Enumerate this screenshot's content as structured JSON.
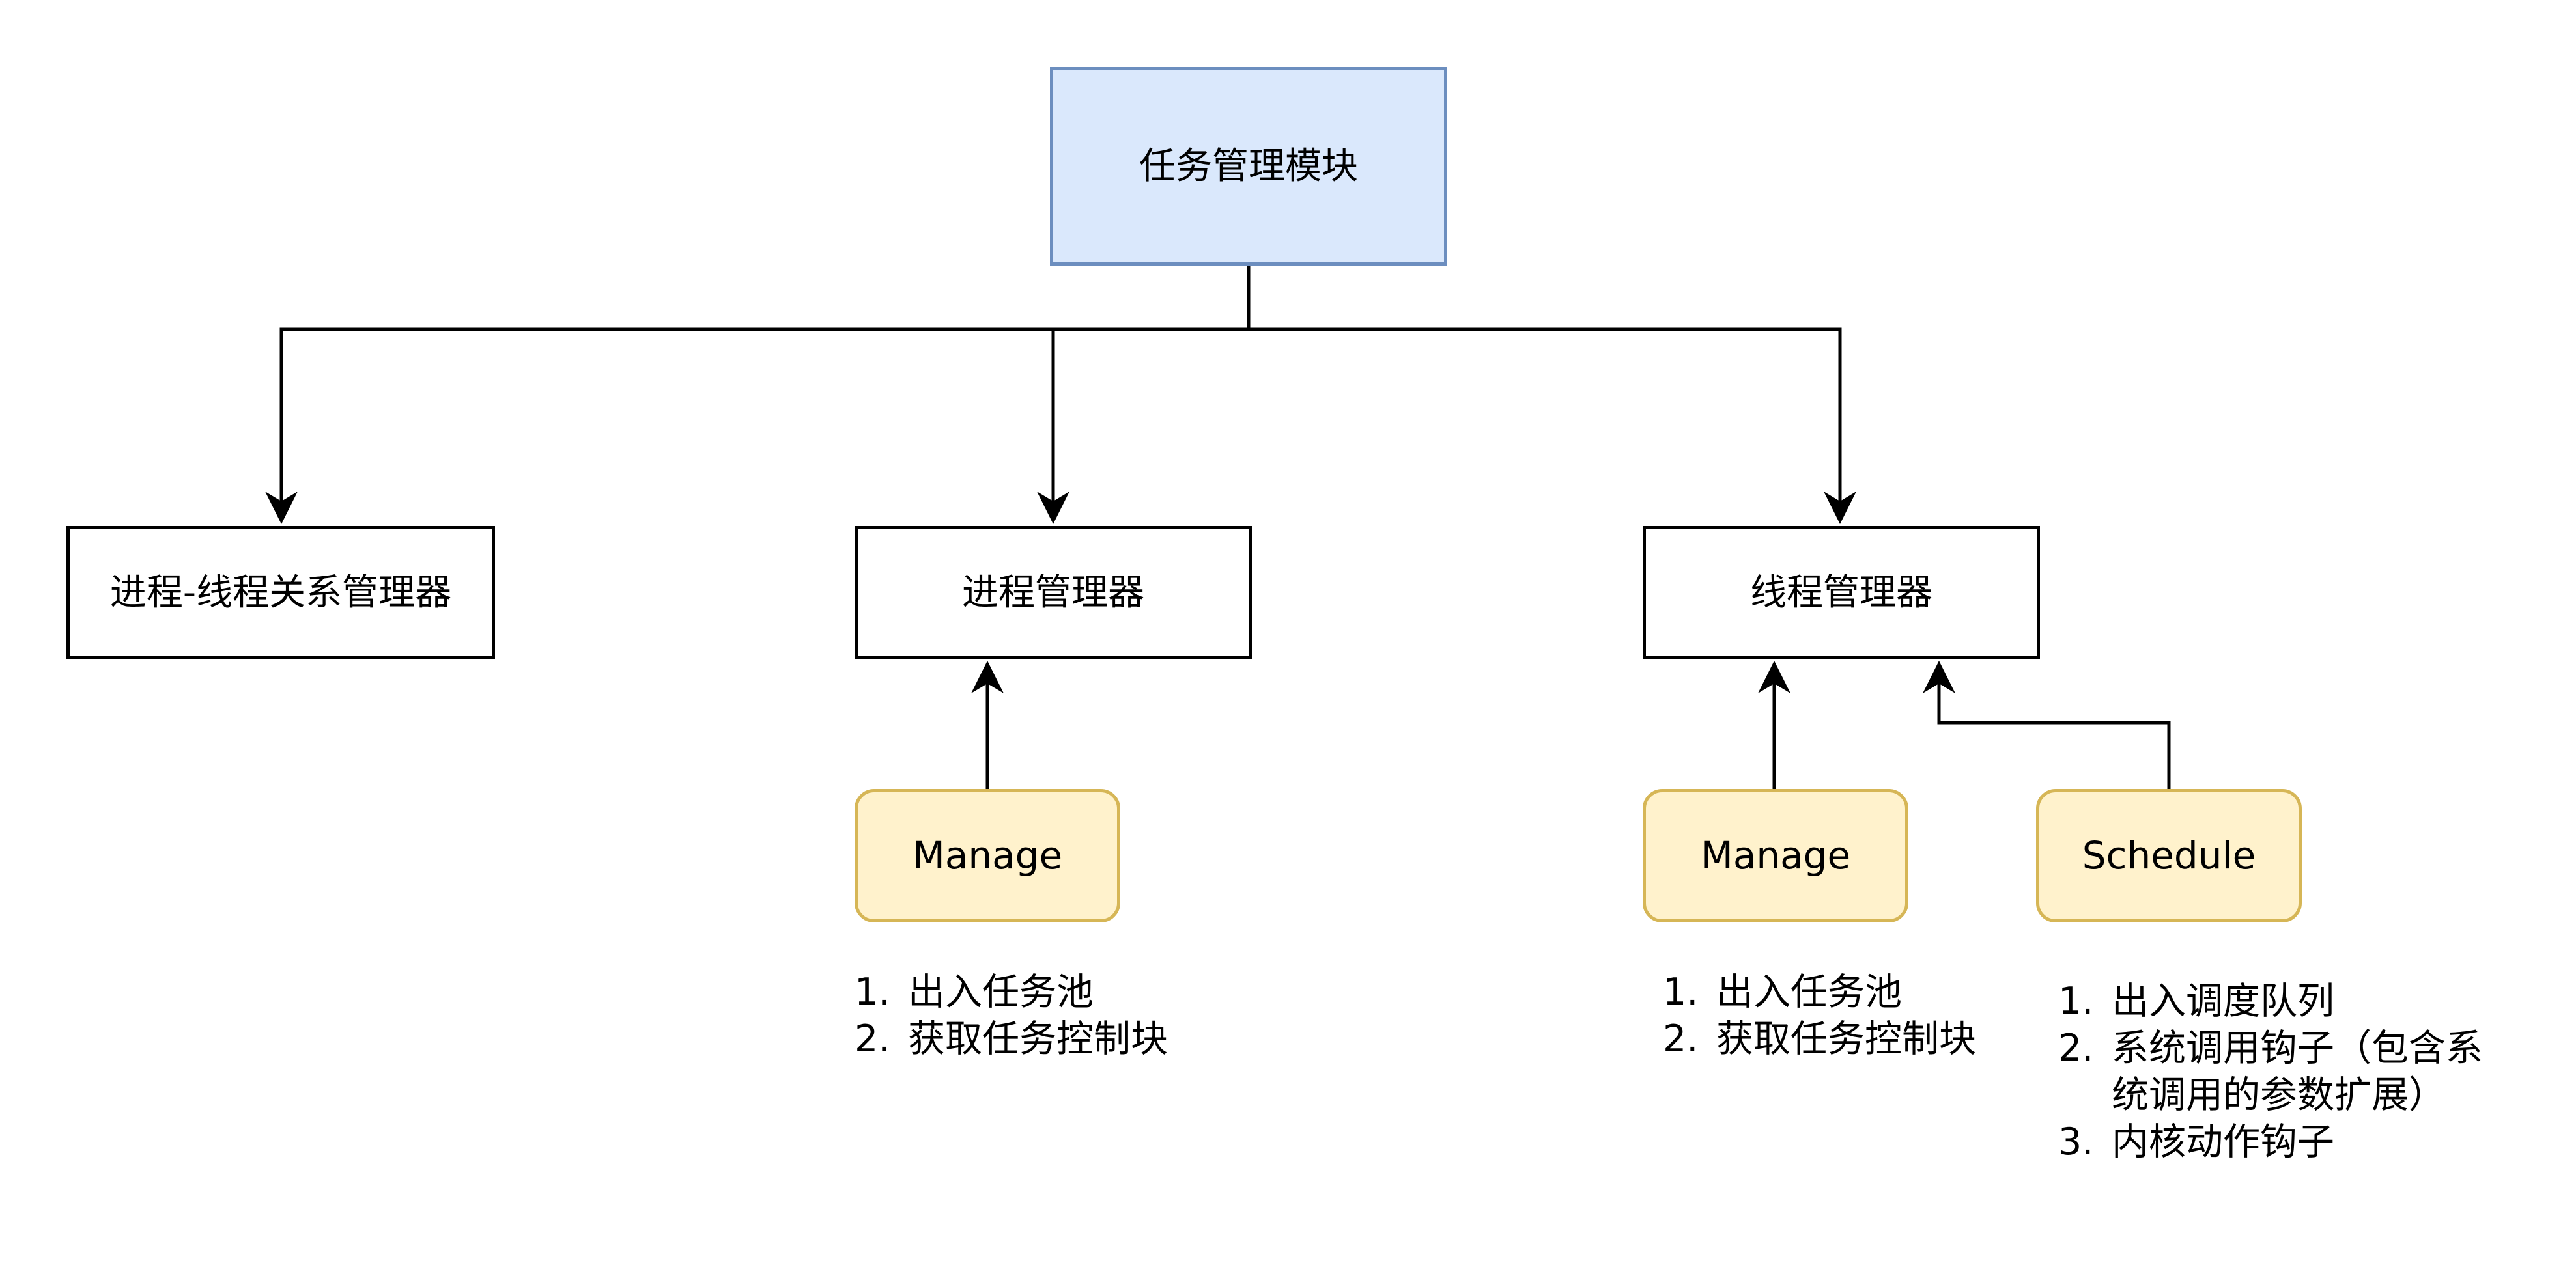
{
  "root": {
    "label": "任务管理模块"
  },
  "managers": [
    {
      "label": "进程-线程关系管理器"
    },
    {
      "label": "进程管理器"
    },
    {
      "label": "线程管理器"
    }
  ],
  "modules": [
    {
      "label": "Manage"
    },
    {
      "label": "Manage"
    },
    {
      "label": "Schedule"
    }
  ],
  "notes": [
    {
      "items": [
        {
          "num": "1.",
          "text": "出入任务池"
        },
        {
          "num": "2.",
          "text": "获取任务控制块"
        }
      ]
    },
    {
      "items": [
        {
          "num": "1.",
          "text": "出入任务池"
        },
        {
          "num": "2.",
          "text": "获取任务控制块"
        }
      ]
    },
    {
      "items": [
        {
          "num": "1.",
          "text": "出入调度队列"
        },
        {
          "num": "2.",
          "text": "系统调用钩子（包含系",
          "text2": "统调用的参数扩展）"
        },
        {
          "num": "3.",
          "text": "内核动作钩子"
        }
      ]
    }
  ],
  "colors": {
    "root_fill": "#dae8fc",
    "root_stroke": "#6c8ebf",
    "module_fill": "#fff2cc",
    "module_stroke": "#d6b656",
    "line": "#000000"
  }
}
